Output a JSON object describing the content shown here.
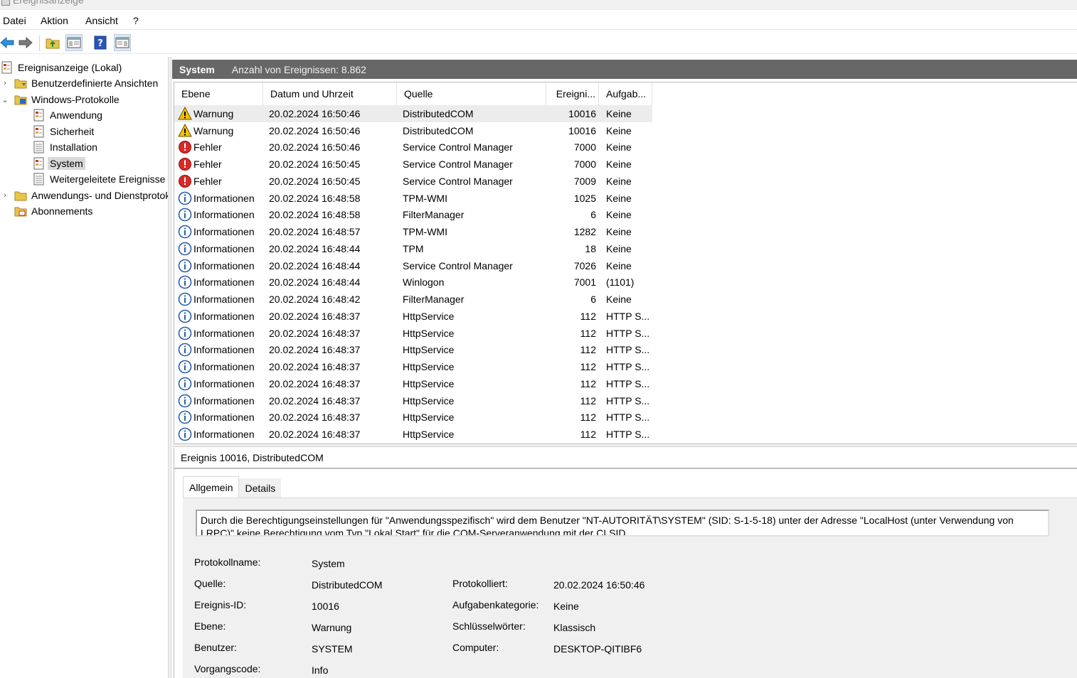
{
  "window": {
    "title": "Ereignisanzeige"
  },
  "menu": {
    "items": [
      "Datei",
      "Aktion",
      "Ansicht",
      "?"
    ]
  },
  "toolbar": {
    "icons": [
      "back-arrow-icon",
      "forward-arrow-icon",
      "folder-up-icon",
      "show-hide-tree-icon",
      "help-icon",
      "show-hide-action-pane-icon"
    ]
  },
  "tree": {
    "root": "Ereignisanzeige (Lokal)",
    "custom_views": "Benutzerdefinierte Ansichten",
    "windows_logs": "Windows-Protokolle",
    "logs": [
      "Anwendung",
      "Sicherheit",
      "Installation",
      "System",
      "Weitergeleitete Ereignisse"
    ],
    "app_services": "Anwendungs- und Dienstprotokolle",
    "subscriptions": "Abonnements"
  },
  "panel": {
    "name": "System",
    "count": "Anzahl von Ereignissen: 8.862"
  },
  "columns": [
    "Ebene",
    "Datum und Uhrzeit",
    "Quelle",
    "Ereigni...",
    "Aufgab..."
  ],
  "events": [
    {
      "level": "Warnung",
      "type": "warn",
      "dt": "20.02.2024 16:50:46",
      "src": "DistributedCOM",
      "id": "10016",
      "task": "Keine"
    },
    {
      "level": "Warnung",
      "type": "warn",
      "dt": "20.02.2024 16:50:46",
      "src": "DistributedCOM",
      "id": "10016",
      "task": "Keine"
    },
    {
      "level": "Fehler",
      "type": "error",
      "dt": "20.02.2024 16:50:46",
      "src": "Service Control Manager",
      "id": "7000",
      "task": "Keine"
    },
    {
      "level": "Fehler",
      "type": "error",
      "dt": "20.02.2024 16:50:45",
      "src": "Service Control Manager",
      "id": "7000",
      "task": "Keine"
    },
    {
      "level": "Fehler",
      "type": "error",
      "dt": "20.02.2024 16:50:45",
      "src": "Service Control Manager",
      "id": "7009",
      "task": "Keine"
    },
    {
      "level": "Informationen",
      "type": "info",
      "dt": "20.02.2024 16:48:58",
      "src": "TPM-WMI",
      "id": "1025",
      "task": "Keine"
    },
    {
      "level": "Informationen",
      "type": "info",
      "dt": "20.02.2024 16:48:58",
      "src": "FilterManager",
      "id": "6",
      "task": "Keine"
    },
    {
      "level": "Informationen",
      "type": "info",
      "dt": "20.02.2024 16:48:57",
      "src": "TPM-WMI",
      "id": "1282",
      "task": "Keine"
    },
    {
      "level": "Informationen",
      "type": "info",
      "dt": "20.02.2024 16:48:44",
      "src": "TPM",
      "id": "18",
      "task": "Keine"
    },
    {
      "level": "Informationen",
      "type": "info",
      "dt": "20.02.2024 16:48:44",
      "src": "Service Control Manager",
      "id": "7026",
      "task": "Keine"
    },
    {
      "level": "Informationen",
      "type": "info",
      "dt": "20.02.2024 16:48:44",
      "src": "Winlogon",
      "id": "7001",
      "task": "(1101)"
    },
    {
      "level": "Informationen",
      "type": "info",
      "dt": "20.02.2024 16:48:42",
      "src": "FilterManager",
      "id": "6",
      "task": "Keine"
    },
    {
      "level": "Informationen",
      "type": "info",
      "dt": "20.02.2024 16:48:37",
      "src": "HttpService",
      "id": "112",
      "task": "HTTP S..."
    },
    {
      "level": "Informationen",
      "type": "info",
      "dt": "20.02.2024 16:48:37",
      "src": "HttpService",
      "id": "112",
      "task": "HTTP S..."
    },
    {
      "level": "Informationen",
      "type": "info",
      "dt": "20.02.2024 16:48:37",
      "src": "HttpService",
      "id": "112",
      "task": "HTTP S..."
    },
    {
      "level": "Informationen",
      "type": "info",
      "dt": "20.02.2024 16:48:37",
      "src": "HttpService",
      "id": "112",
      "task": "HTTP S..."
    },
    {
      "level": "Informationen",
      "type": "info",
      "dt": "20.02.2024 16:48:37",
      "src": "HttpService",
      "id": "112",
      "task": "HTTP S..."
    },
    {
      "level": "Informationen",
      "type": "info",
      "dt": "20.02.2024 16:48:37",
      "src": "HttpService",
      "id": "112",
      "task": "HTTP S..."
    },
    {
      "level": "Informationen",
      "type": "info",
      "dt": "20.02.2024 16:48:37",
      "src": "HttpService",
      "id": "112",
      "task": "HTTP S..."
    },
    {
      "level": "Informationen",
      "type": "info",
      "dt": "20.02.2024 16:48:37",
      "src": "HttpService",
      "id": "112",
      "task": "HTTP S..."
    }
  ],
  "detail": {
    "title": "Ereignis 10016, DistributedCOM",
    "tabs": [
      "Allgemein",
      "Details"
    ],
    "description": "Durch die Berechtigungseinstellungen für \"Anwendungsspezifisch\" wird dem Benutzer \"NT-AUTORITÄT\\SYSTEM\" (SID: S-1-5-18) unter der Adresse \"LocalHost (unter Verwendung von LRPC)\" keine Berechtigung vom Typ \"Lokal Start\" für die COM-Serveranwendung mit der CLSID",
    "fields": {
      "protokollname_label": "Protokollname:",
      "protokollname": "System",
      "quelle_label": "Quelle:",
      "quelle": "DistributedCOM",
      "protokolliert_label": "Protokolliert:",
      "protokolliert": "20.02.2024 16:50:46",
      "ereignisid_label": "Ereignis-ID:",
      "ereignisid": "10016",
      "aufgabe_label": "Aufgabenkategorie:",
      "aufgabe": "Keine",
      "ebene_label": "Ebene:",
      "ebene": "Warnung",
      "schluessel_label": "Schlüsselwörter:",
      "schluessel": "Klassisch",
      "benutzer_label": "Benutzer:",
      "benutzer": "SYSTEM",
      "computer_label": "Computer:",
      "computer": "DESKTOP-QITIBF6",
      "vorgang_label": "Vorgangscode:",
      "vorgang": "Info"
    }
  },
  "colors": {
    "header_bg": "#676767",
    "selected_row": "#ececec",
    "warn": "#f2c200",
    "error": "#d92a2a",
    "info": "#2b5fa8"
  }
}
